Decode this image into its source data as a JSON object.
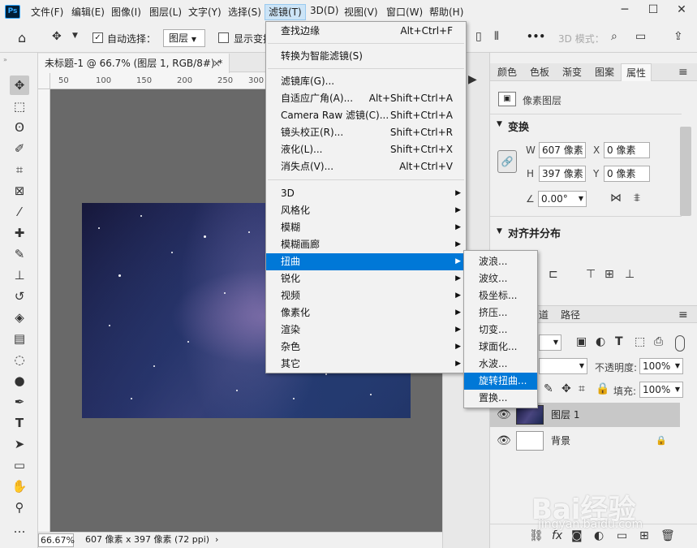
{
  "app": {
    "logo": "Ps"
  },
  "menubar": {
    "items": [
      "文件(F)",
      "编辑(E)",
      "图像(I)",
      "图层(L)",
      "文字(Y)",
      "选择(S)",
      "滤镜(T)",
      "3D(D)",
      "视图(V)",
      "窗口(W)",
      "帮助(H)"
    ],
    "active_index": 6
  },
  "window_controls": {
    "minimize": "─",
    "maximize": "☐",
    "close": "✕"
  },
  "options_bar": {
    "auto_select_label": "自动选择：",
    "auto_select_value": "图层",
    "show_transform_label": "显示变换",
    "mode_3d_label": "3D 模式：",
    "more": "•••"
  },
  "document": {
    "tab_title": "未标题-1 @ 66.7% (图层 1, RGB/8#) *",
    "tab_close": "×",
    "ruler_marks": [
      "50",
      "100",
      "150",
      "200",
      "250",
      "300"
    ]
  },
  "status": {
    "zoom": "66.67%",
    "info": "607 像素 x 397 像素 (72 ppi)",
    "arrow": "›"
  },
  "filter_menu": {
    "items": [
      {
        "label": "查找边缘",
        "shortcut": "Alt+Ctrl+F",
        "submenu": false
      },
      {
        "label": "转换为智能滤镜(S)",
        "shortcut": "",
        "submenu": false
      },
      {
        "label": "滤镜库(G)...",
        "shortcut": "",
        "submenu": false
      },
      {
        "label": "自适应广角(A)...",
        "shortcut": "Alt+Shift+Ctrl+A",
        "submenu": false
      },
      {
        "label": "Camera Raw 滤镜(C)...",
        "shortcut": "Shift+Ctrl+A",
        "submenu": false
      },
      {
        "label": "镜头校正(R)...",
        "shortcut": "Shift+Ctrl+R",
        "submenu": false
      },
      {
        "label": "液化(L)...",
        "shortcut": "Shift+Ctrl+X",
        "submenu": false
      },
      {
        "label": "消失点(V)...",
        "shortcut": "Alt+Ctrl+V",
        "submenu": false
      },
      {
        "label": "3D",
        "shortcut": "",
        "submenu": true
      },
      {
        "label": "风格化",
        "shortcut": "",
        "submenu": true
      },
      {
        "label": "模糊",
        "shortcut": "",
        "submenu": true
      },
      {
        "label": "模糊画廊",
        "shortcut": "",
        "submenu": true
      },
      {
        "label": "扭曲",
        "shortcut": "",
        "submenu": true
      },
      {
        "label": "锐化",
        "shortcut": "",
        "submenu": true
      },
      {
        "label": "视频",
        "shortcut": "",
        "submenu": true
      },
      {
        "label": "像素化",
        "shortcut": "",
        "submenu": true
      },
      {
        "label": "渲染",
        "shortcut": "",
        "submenu": true
      },
      {
        "label": "杂色",
        "shortcut": "",
        "submenu": true
      },
      {
        "label": "其它",
        "shortcut": "",
        "submenu": true
      }
    ],
    "highlighted": "扭曲"
  },
  "distort_submenu": {
    "items": [
      "波浪...",
      "波纹...",
      "极坐标...",
      "挤压...",
      "切变...",
      "球面化...",
      "水波...",
      "旋转扭曲...",
      "置换..."
    ],
    "highlighted": "旋转扭曲..."
  },
  "panel_tabs": [
    "颜色",
    "色板",
    "渐变",
    "图案",
    "属性"
  ],
  "panel_active_tab": "属性",
  "properties": {
    "layer_type": "像素图层",
    "transform_title": "变换",
    "w_label": "W",
    "w_value": "607 像素",
    "h_label": "H",
    "h_value": "397 像素",
    "x_label": "X",
    "x_value": "0 像素",
    "y_label": "Y",
    "y_value": "0 像素",
    "angle_value": "0.00°",
    "align_title": "对齐并分布"
  },
  "layers_panel": {
    "tabs": [
      "道",
      "路径"
    ],
    "opacity_label": "不透明度:",
    "opacity_value": "100%",
    "fill_label": "填充:",
    "fill_value": "100%",
    "layers": [
      {
        "name": "图层 1",
        "selected": true
      },
      {
        "name": "背景",
        "selected": false
      }
    ]
  },
  "watermark": {
    "brand": "Bai经验",
    "url": "jingyan.baidu.com"
  },
  "colors": {
    "highlight": "#0078d7",
    "canvas_bg": "#696969",
    "selected_layer": "#c8c8c8"
  }
}
